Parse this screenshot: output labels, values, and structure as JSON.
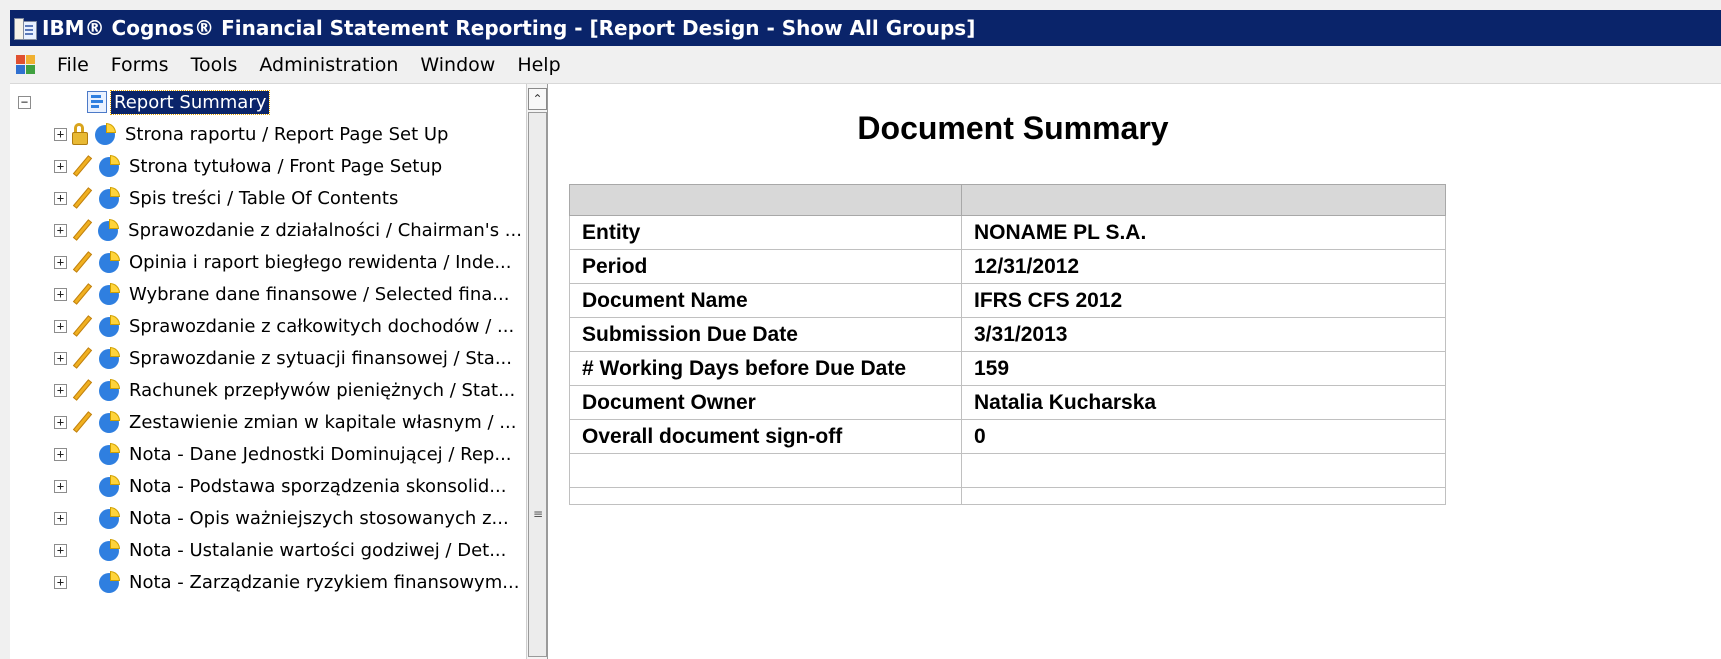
{
  "window": {
    "title": "IBM® Cognos® Financial Statement Reporting - [Report Design - Show All Groups]"
  },
  "menu": {
    "items": [
      "File",
      "Forms",
      "Tools",
      "Administration",
      "Window",
      "Help"
    ]
  },
  "tree": {
    "root": "Report Summary",
    "items": [
      {
        "label": "Strona raportu / Report Page Set Up",
        "status": "lock"
      },
      {
        "label": "Strona tytułowa / Front Page Setup",
        "status": "pencil"
      },
      {
        "label": "Spis treści / Table Of Contents",
        "status": "pencil"
      },
      {
        "label": "Sprawozdanie z działalności / Chairman's ...",
        "status": "pencil"
      },
      {
        "label": "Opinia i raport biegłego rewidenta / Inde...",
        "status": "pencil"
      },
      {
        "label": "Wybrane dane finansowe / Selected fina...",
        "status": "pencil"
      },
      {
        "label": "Sprawozdanie z całkowitych dochodów / ...",
        "status": "pencil"
      },
      {
        "label": "Sprawozdanie z sytuacji finansowej / Sta...",
        "status": "pencil"
      },
      {
        "label": "Rachunek przepływów pieniężnych / Stat...",
        "status": "pencil"
      },
      {
        "label": "Zestawienie zmian w kapitale własnym / ...",
        "status": "pencil"
      },
      {
        "label": "Nota - Dane Jednostki Dominującej / Rep...",
        "status": "none"
      },
      {
        "label": "Nota - Podstawa sporządzenia skonsolid...",
        "status": "none"
      },
      {
        "label": "Nota - Opis ważniejszych stosowanych z...",
        "status": "none"
      },
      {
        "label": "Nota - Ustalanie wartości godziwej / Det...",
        "status": "none"
      },
      {
        "label": "Nota - Zarządzanie ryzykiem finansowym...",
        "status": "none"
      }
    ]
  },
  "summary": {
    "title": "Document Summary",
    "rows": [
      {
        "label": "Entity",
        "value": "NONAME PL S.A."
      },
      {
        "label": "Period",
        "value": "12/31/2012"
      },
      {
        "label": "Document Name",
        "value": "IFRS CFS 2012"
      },
      {
        "label": "Submission Due Date",
        "value": "3/31/2013"
      },
      {
        "label": "# Working Days before Due Date",
        "value": "159"
      },
      {
        "label": "Document Owner",
        "value": "Natalia Kucharska"
      },
      {
        "label": "Overall document sign-off",
        "value": "0"
      }
    ]
  }
}
